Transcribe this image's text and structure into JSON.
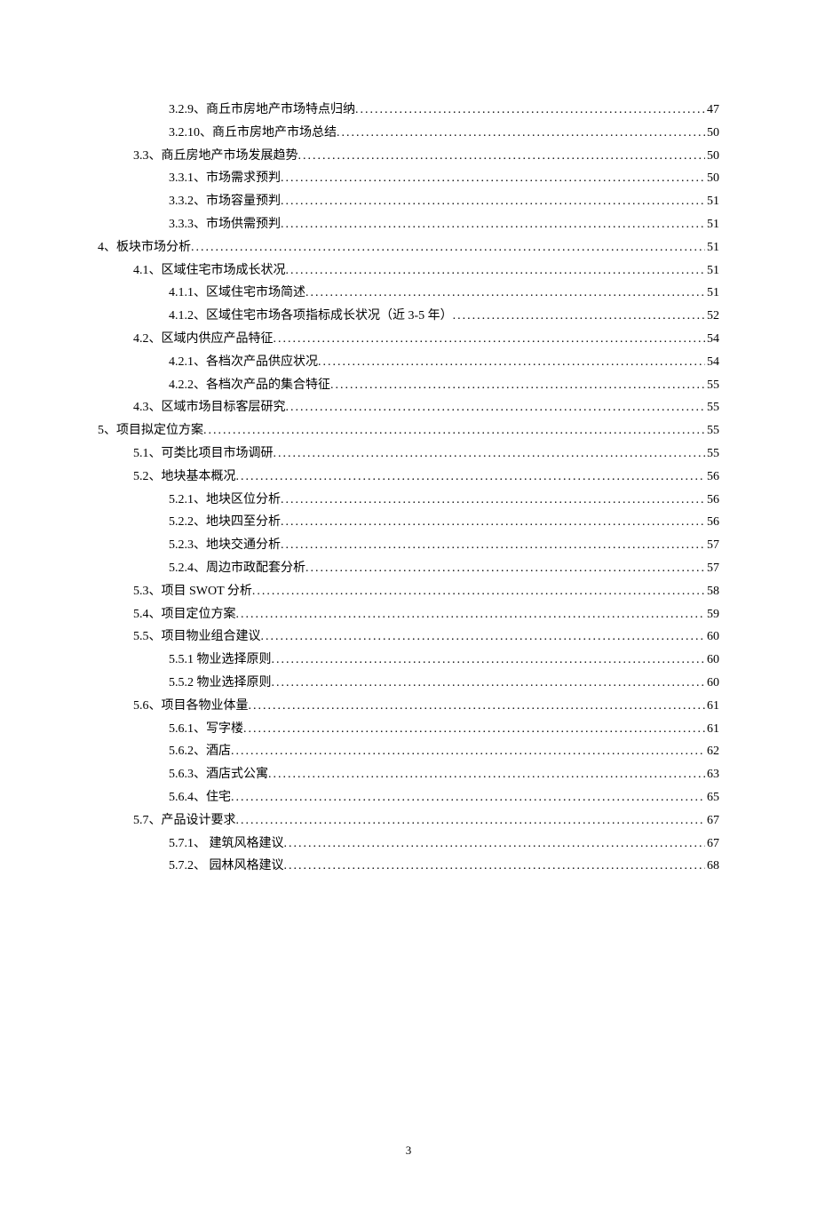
{
  "toc": [
    {
      "level": 3,
      "label": "3.2.9、商丘市房地产市场特点归纳",
      "page": "47"
    },
    {
      "level": 3,
      "label": "3.2.10、商丘市房地产市场总结",
      "page": "50"
    },
    {
      "level": 2,
      "label": "3.3、商丘房地产市场发展趋势",
      "page": "50"
    },
    {
      "level": 3,
      "label": "3.3.1、市场需求预判",
      "page": "50"
    },
    {
      "level": 3,
      "label": "3.3.2、市场容量预判",
      "page": "51"
    },
    {
      "level": 3,
      "label": "3.3.3、市场供需预判",
      "page": "51"
    },
    {
      "level": 1,
      "label": "4、板块市场分析",
      "page": "51"
    },
    {
      "level": 2,
      "label": "4.1、区域住宅市场成长状况",
      "page": "51"
    },
    {
      "level": 3,
      "label": "4.1.1、区域住宅市场简述",
      "page": "51"
    },
    {
      "level": 3,
      "label": "4.1.2、区域住宅市场各项指标成长状况（近 3-5 年）",
      "page": "52"
    },
    {
      "level": 2,
      "label": "4.2、区域内供应产品特征",
      "page": "54"
    },
    {
      "level": 3,
      "label": "4.2.1、各档次产品供应状况",
      "page": "54"
    },
    {
      "level": 3,
      "label": "4.2.2、各档次产品的集合特征",
      "page": "55"
    },
    {
      "level": 2,
      "label": "4.3、区域市场目标客层研究",
      "page": "55"
    },
    {
      "level": 1,
      "label": "5、项目拟定位方案",
      "page": "55"
    },
    {
      "level": 2,
      "label": "5.1、可类比项目市场调研",
      "page": "55"
    },
    {
      "level": 2,
      "label": "5.2、地块基本概况",
      "page": "56"
    },
    {
      "level": 3,
      "label": "5.2.1、地块区位分析",
      "page": "56"
    },
    {
      "level": 3,
      "label": "5.2.2、地块四至分析",
      "page": "56"
    },
    {
      "level": 3,
      "label": "5.2.3、地块交通分析",
      "page": "57"
    },
    {
      "level": 3,
      "label": "5.2.4、周边市政配套分析",
      "page": "57"
    },
    {
      "level": 2,
      "label": "5.3、项目 SWOT 分析",
      "page": "58"
    },
    {
      "level": 2,
      "label": "5.4、项目定位方案",
      "page": "59"
    },
    {
      "level": 2,
      "label": "5.5、项目物业组合建议",
      "page": "60"
    },
    {
      "level": 3,
      "label": "5.5.1 物业选择原则",
      "page": "60"
    },
    {
      "level": 3,
      "label": "5.5.2 物业选择原则",
      "page": "60"
    },
    {
      "level": 2,
      "label": "5.6、项目各物业体量",
      "page": "61"
    },
    {
      "level": 3,
      "label": "5.6.1、写字楼",
      "page": "61"
    },
    {
      "level": 3,
      "label": "5.6.2、酒店",
      "page": "62"
    },
    {
      "level": 3,
      "label": "5.6.3、酒店式公寓",
      "page": "63"
    },
    {
      "level": 3,
      "label": "5.6.4、住宅",
      "page": "65"
    },
    {
      "level": 2,
      "label": "5.7、产品设计要求",
      "page": "67"
    },
    {
      "level": 3,
      "label": "5.7.1、 建筑风格建议",
      "page": "67"
    },
    {
      "level": 3,
      "label": "5.7.2、 园林风格建议",
      "page": "68"
    }
  ],
  "page_number": "3"
}
